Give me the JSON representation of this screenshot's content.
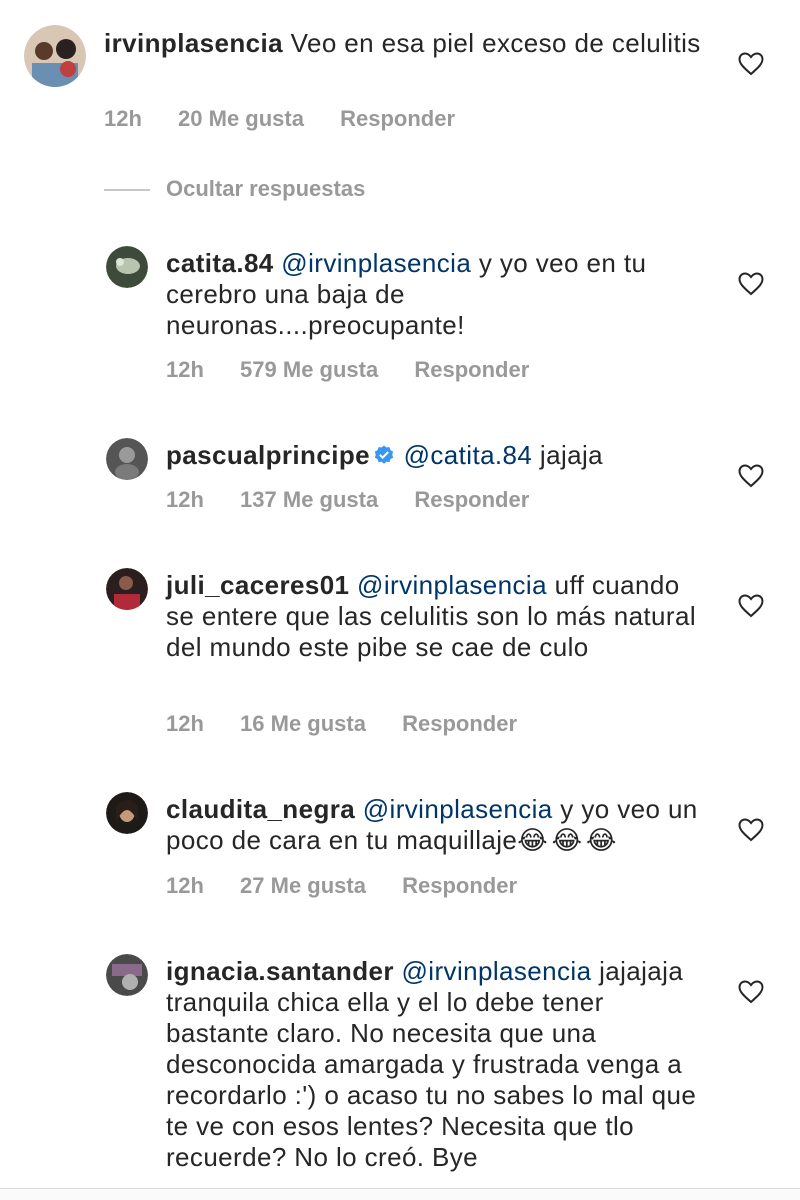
{
  "comments": [
    {
      "username": "irvinplasencia",
      "text": "Veo en esa piel exceso de celulitis",
      "time": "12h",
      "likes": "20 Me gusta",
      "reply": "Responder"
    },
    {
      "username": "catita.84",
      "mention": "@irvinplasencia",
      "text": "y yo veo en tu cerebro una baja de neuronas....preocupante!",
      "time": "12h",
      "likes": "579 Me gusta",
      "reply": "Responder"
    },
    {
      "username": "pascualprincipe",
      "mention": "@catita.84",
      "text": "jajaja",
      "time": "12h",
      "likes": "137 Me gusta",
      "reply": "Responder",
      "verified": true
    },
    {
      "username": "juli_caceres01",
      "mention": "@irvinplasencia",
      "text": "uff cuando se entere que las celulitis son lo más natural del mundo este pibe se cae de culo",
      "time": "12h",
      "likes": "16 Me gusta",
      "reply": "Responder"
    },
    {
      "username": "claudita_negra",
      "mention": "@irvinplasencia",
      "text": "y yo veo un poco de cara en tu maquillaje",
      "emoji": "😂😂😂",
      "time": "12h",
      "likes": "27 Me gusta",
      "reply": "Responder"
    },
    {
      "username": "ignacia.santander",
      "mention": "@irvinplasencia",
      "text": "jajajaja tranquila chica ella y el lo debe tener bastante claro. No necesita que una desconocida amargada y frustrada venga a recordarlo :') o acaso tu no sabes lo mal que te ve con esos lentes? Necesita que tlo recuerde? No lo creó. Bye"
    }
  ],
  "hide_replies_label": "Ocultar respuestas",
  "icons": {
    "like": "heart-outline-icon",
    "verified": "verified-badge-icon"
  },
  "colors": {
    "text": "#262626",
    "mention": "#003569",
    "meta": "#999999",
    "verified": "#3897f0"
  }
}
